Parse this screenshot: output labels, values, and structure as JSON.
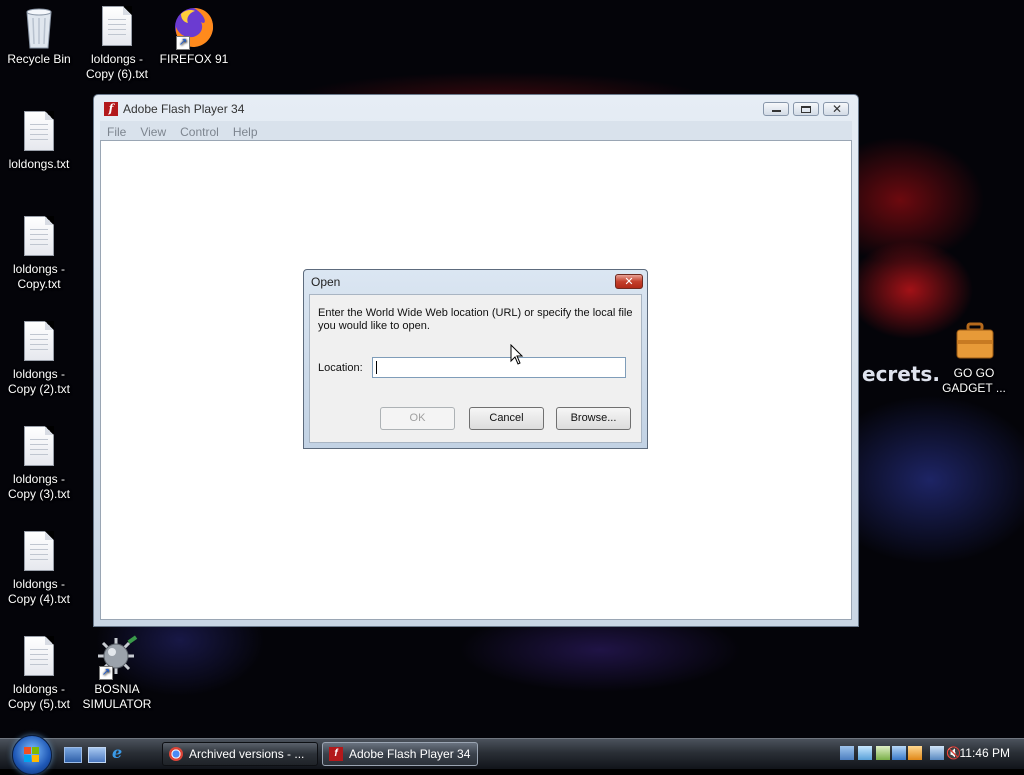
{
  "desktop": {
    "icons": [
      {
        "label": "Recycle Bin"
      },
      {
        "label": "loldongs - Copy (6).txt"
      },
      {
        "label": "FIREFOX 91"
      },
      {
        "label": "loldongs.txt"
      },
      {
        "label": "loldongs - Copy.txt"
      },
      {
        "label": "loldongs - Copy (2).txt"
      },
      {
        "label": "loldongs - Copy (3).txt"
      },
      {
        "label": "loldongs - Copy (4).txt"
      },
      {
        "label": "loldongs - Copy (5).txt"
      },
      {
        "label": "BOSNIA SIMULATOR"
      },
      {
        "label": "GO GO GADGET ..."
      }
    ]
  },
  "flash_window": {
    "title": "Adobe Flash Player 34",
    "menu": [
      "File",
      "View",
      "Control",
      "Help"
    ]
  },
  "open_dialog": {
    "title": "Open",
    "prompt": "Enter the World Wide Web location (URL) or specify the local file you would like to open.",
    "location_label": "Location:",
    "location_value": "",
    "ok_label": "OK",
    "cancel_label": "Cancel",
    "browse_label": "Browse..."
  },
  "wallpaper": {
    "fragment": "ecrets."
  },
  "taskbar": {
    "tasks": [
      {
        "label": "Archived versions - ..."
      },
      {
        "label": "Adobe Flash Player 34"
      }
    ],
    "clock": "11:46 PM"
  }
}
